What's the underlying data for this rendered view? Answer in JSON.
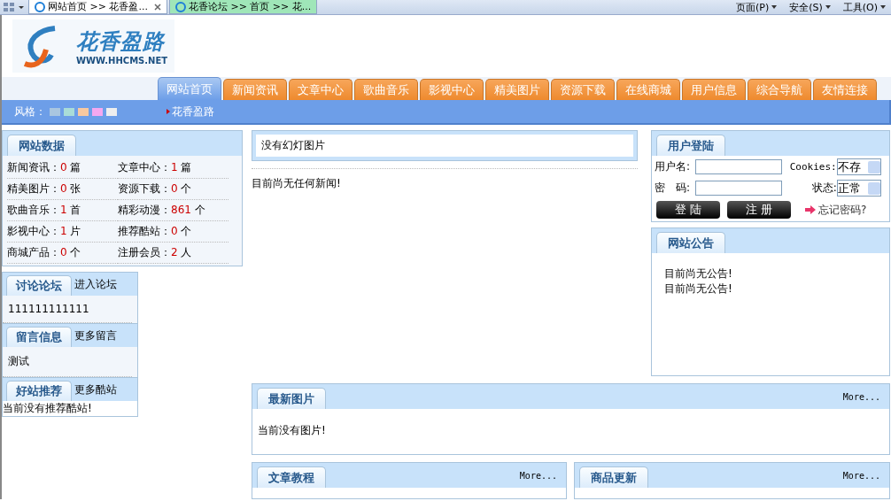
{
  "browser": {
    "tabs": [
      {
        "label": "网站首页 >> 花香盈...",
        "selected": true
      },
      {
        "label": "花香论坛 >> 首页 >> 花...",
        "selected": false
      }
    ],
    "tools": [
      "页面(P)",
      "安全(S)",
      "工具(O)"
    ]
  },
  "header": {
    "logo_text": "花香盈路",
    "logo_url": "WWW.HHCMS.NET"
  },
  "nav": [
    {
      "label": "网站首页",
      "selected": true
    },
    {
      "label": "新闻资讯",
      "selected": false
    },
    {
      "label": "文章中心",
      "selected": false
    },
    {
      "label": "歌曲音乐",
      "selected": false
    },
    {
      "label": "影视中心",
      "selected": false
    },
    {
      "label": "精美图片",
      "selected": false
    },
    {
      "label": "资源下载",
      "selected": false
    },
    {
      "label": "在线商城",
      "selected": false
    },
    {
      "label": "用户信息",
      "selected": false
    },
    {
      "label": "综合导航",
      "selected": false
    },
    {
      "label": "友情连接",
      "selected": false
    }
  ],
  "style_bar": {
    "label": "风格：",
    "swatches": [
      {
        "color": "#a9c6e0"
      },
      {
        "color": "#a9dcd8"
      },
      {
        "color": "#f8c9a0"
      },
      {
        "color": "#f4a8f0"
      },
      {
        "color": "#eeeeee"
      }
    ],
    "site_link": "花香盈路"
  },
  "stats": {
    "title": "网站数据",
    "items": [
      {
        "label": "新闻资讯：",
        "value": "0",
        "unit": "篇"
      },
      {
        "label": "文章中心：",
        "value": "1",
        "unit": "篇"
      },
      {
        "label": "精美图片：",
        "value": "0",
        "unit": "张"
      },
      {
        "label": "资源下载：",
        "value": "0",
        "unit": "个"
      },
      {
        "label": "歌曲音乐：",
        "value": "1",
        "unit": "首"
      },
      {
        "label": "精彩动漫：",
        "value": "861",
        "unit": "个"
      },
      {
        "label": "影视中心：",
        "value": "1",
        "unit": "片"
      },
      {
        "label": "推荐酷站：",
        "value": "0",
        "unit": "个"
      },
      {
        "label": "商城产品：",
        "value": "0",
        "unit": "个"
      },
      {
        "label": "注册会员：",
        "value": "2",
        "unit": "人"
      }
    ]
  },
  "side_panels": [
    {
      "title": "讨论论坛",
      "link": "进入论坛",
      "items": [
        "111111111111"
      ]
    },
    {
      "title": "留言信息",
      "link": "更多留言",
      "items": [
        "测试"
      ]
    },
    {
      "title": "好站推荐",
      "link": "更多酷站"
    }
  ],
  "side_empty": "当前没有推荐酷站!",
  "slideshow": {
    "text": "没有幻灯图片"
  },
  "news_empty": "目前尚无任何新闻!",
  "login": {
    "title": "用户登陆",
    "username_label": "用户名:",
    "password_label": "密　码:",
    "cookies_label": "Cookies:",
    "cookies_value": "不存",
    "status_label": "状态:",
    "status_value": "正常",
    "login_button": "登 陆",
    "register_button": "注 册",
    "forgot": "忘记密码?"
  },
  "notice": {
    "title": "网站公告",
    "items": [
      "目前尚无公告!",
      "目前尚无公告!"
    ]
  },
  "latest_images": {
    "title": "最新图片",
    "more": "More...",
    "empty": "当前没有图片!"
  },
  "articles": {
    "title": "文章教程",
    "more": "More..."
  },
  "products": {
    "title": "商品更新",
    "more": "More..."
  }
}
